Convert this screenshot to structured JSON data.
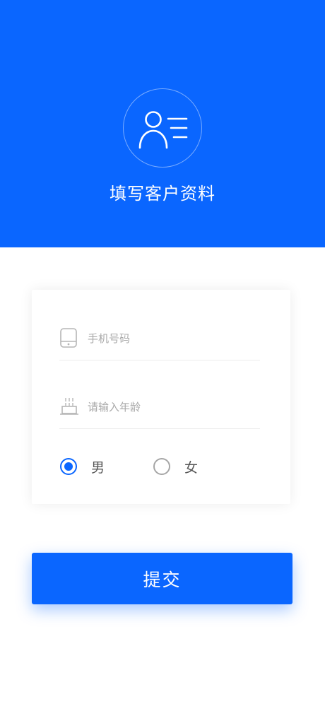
{
  "header": {
    "title": "填写客户资料",
    "icon": "user-list-icon",
    "background_color": "#0a66ff"
  },
  "form": {
    "phone": {
      "icon": "phone-icon",
      "placeholder": "手机号码",
      "value": ""
    },
    "age": {
      "icon": "cake-icon",
      "placeholder": "请输入年龄",
      "value": ""
    },
    "gender": {
      "options": [
        {
          "label": "男",
          "selected": true
        },
        {
          "label": "女",
          "selected": false
        }
      ]
    }
  },
  "actions": {
    "submit_label": "提交",
    "accent_color": "#0a66ff"
  }
}
